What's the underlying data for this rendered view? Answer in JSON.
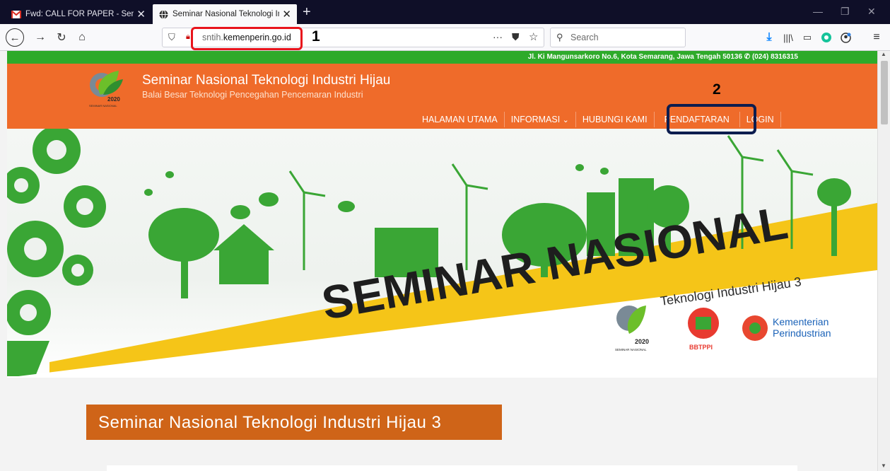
{
  "browser": {
    "tabs": [
      {
        "title": "Fwd: CALL FOR PAPER - Semin",
        "active": false
      },
      {
        "title": "Seminar Nasional Teknologi Ind",
        "active": true
      }
    ],
    "url_prefix": "sntih.",
    "url_domain": "kemenperin.go.id",
    "search_placeholder": "Search"
  },
  "annotations": {
    "marker_1": "1",
    "marker_2": "2"
  },
  "site": {
    "address_line": "Jl. Ki Mangunsarkoro No.6, Kota Semarang, Jawa Tengah 50136 ✆ (024) 8316315",
    "title": "Seminar Nasional Teknologi Industri Hijau",
    "subtitle": "Balai Besar Teknologi Pencegahan Pencemaran Industri",
    "logo_year": "2020",
    "logo_caption": "SEMINAR NASIONAL",
    "menu": {
      "home": "HALAMAN UTAMA",
      "info": "INFORMASI",
      "contact": "HUBUNGI KAMI",
      "register": "PENDAFTARAN",
      "login": "LOGIN"
    }
  },
  "banner": {
    "headline": "SEMINAR NASIONAL",
    "subline": "Teknologi Industri Hijau 3",
    "logo_year": "2020",
    "logo_caption": "SEMINAR NASIONAL",
    "bbtppi": "BBTPPI",
    "ministry_line1": "Kementerian",
    "ministry_line2": "Perindustrian"
  },
  "content": {
    "heading": "Seminar Nasional Teknologi Industri Hijau 3"
  },
  "colors": {
    "header_orange": "#ef6b2a",
    "strip_green": "#2eaa2a",
    "title_box": "#cf6418",
    "banner_yellow": "#f5c518",
    "tree_green": "#3aa635"
  }
}
